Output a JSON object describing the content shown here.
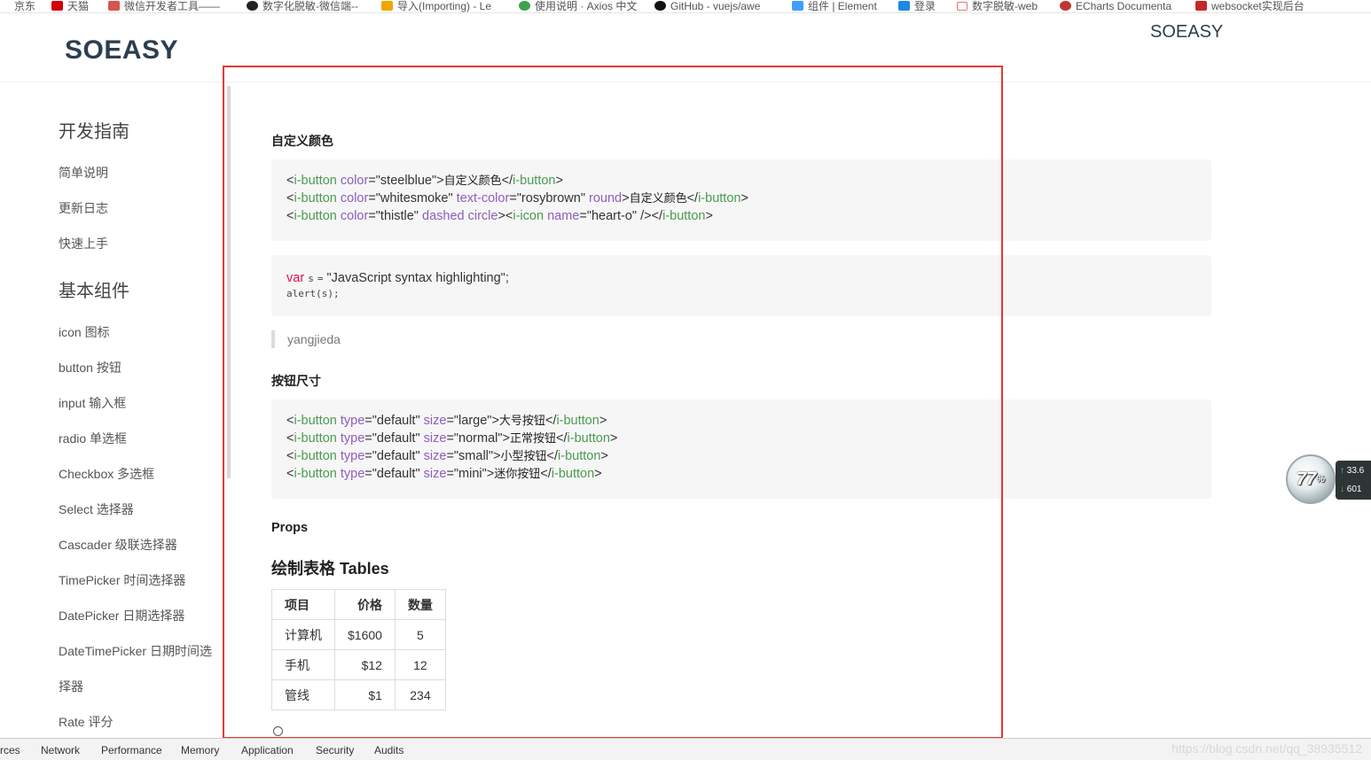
{
  "bookmarks": [
    {
      "label": "京东",
      "color": "#e33"
    },
    {
      "label": "天猫",
      "color": "#d40000"
    },
    {
      "label": "微信开发者工具——",
      "color": "#d9534f"
    },
    {
      "label": "数字化脱敏-微信端--",
      "color": "#222222"
    },
    {
      "label": "导入(Importing) - Le",
      "color": "#f0a500"
    },
    {
      "label": "使用说明 · Axios 中文",
      "color": "#3fa34d"
    },
    {
      "label": "GitHub - vuejs/awe",
      "color": "#111111"
    },
    {
      "label": "组件 | Element",
      "color": "#409eff"
    },
    {
      "label": "登录",
      "color": "#1e88e5"
    },
    {
      "label": "数字脱敏-web",
      "color": "#e57373"
    },
    {
      "label": "ECharts Documenta",
      "color": "#c23531"
    },
    {
      "label": "websocket实现后台",
      "color": "#c62828"
    }
  ],
  "header": {
    "logo": "SOEASY",
    "logo_right": "SOEASY"
  },
  "sidebar": {
    "group1": "开发指南",
    "items1": [
      "简单说明",
      "更新日志",
      "快速上手"
    ],
    "group2": "基本组件",
    "items2": [
      "icon 图标",
      "button 按钮",
      "input 输入框",
      "radio 单选框",
      "Checkbox 多选框",
      "Select 选择器",
      "Cascader 级联选择器",
      "TimePicker 时间选择器",
      "DatePicker 日期选择器",
      "DateTimePicker 日期时间选",
      "择器",
      "Rate 评分"
    ]
  },
  "content": {
    "section_custom_color": "自定义颜色",
    "code1": {
      "l1": {
        "open": "i-button",
        "attr1": "color",
        "val1": "\"steelblue\"",
        "text": "自定义颜色",
        "close": "i-button"
      },
      "l2": {
        "open": "i-button",
        "attr1": "color",
        "val1": "\"whitesmoke\"",
        "attr2": "text-color",
        "val2": "\"rosybrown\"",
        "attr3": "round",
        "text": "自定义颜色",
        "close": "i-button"
      },
      "l3": {
        "open": "i-button",
        "attr1": "color",
        "val1": "\"thistle\"",
        "attr2": "dashed circle",
        "inner": "i-icon",
        "attr3": "name",
        "val3": "\"heart-o\"",
        "close": "i-button"
      }
    },
    "code2": {
      "kw": "var",
      "var": "s",
      "eq": "=",
      "str": "\"JavaScript syntax highlighting\";",
      "line2": "alert(s);"
    },
    "quote": "yangjieda",
    "section_button_size": "按钮尺寸",
    "code3": [
      {
        "open": "i-button",
        "attr1": "type",
        "val1": "\"default\"",
        "attr2": "size",
        "val2": "\"large\"",
        "text": "大号按钮",
        "close": "i-button"
      },
      {
        "open": "i-button",
        "attr1": "type",
        "val1": "\"default\"",
        "attr2": "size",
        "val2": "\"normal\"",
        "text": "正常按钮",
        "close": "i-button"
      },
      {
        "open": "i-button",
        "attr1": "type",
        "val1": "\"default\"",
        "attr2": "size",
        "val2": "\"small\"",
        "text": "小型按钮",
        "close": "i-button"
      },
      {
        "open": "i-button",
        "attr1": "type",
        "val1": "\"default\"",
        "attr2": "size",
        "val2": "\"mini\"",
        "text": "迷你按钮",
        "close": "i-button"
      }
    ],
    "props_title": "Props",
    "tables_title": "绘制表格 Tables",
    "table": {
      "headers": [
        "项目",
        "价格",
        "数量"
      ],
      "rows": [
        [
          "计算机",
          "$1600",
          "5"
        ],
        [
          "手机",
          "$12",
          "12"
        ],
        [
          "管线",
          "$1",
          "234"
        ]
      ]
    }
  },
  "devtools": {
    "tabs": [
      "rces",
      "Network",
      "Performance",
      "Memory",
      "Application",
      "Security",
      "Audits"
    ],
    "watermark": "https://blog.csdn.net/qq_38935512"
  },
  "net_widget": {
    "percent": "77",
    "pct_sign": "%",
    "up": "33.6",
    "down": "601"
  },
  "colors": {
    "highlight_frame": "#e53935",
    "tag": "#4a9b4c",
    "attr": "#8e5fb7",
    "keyword": "#d14"
  }
}
